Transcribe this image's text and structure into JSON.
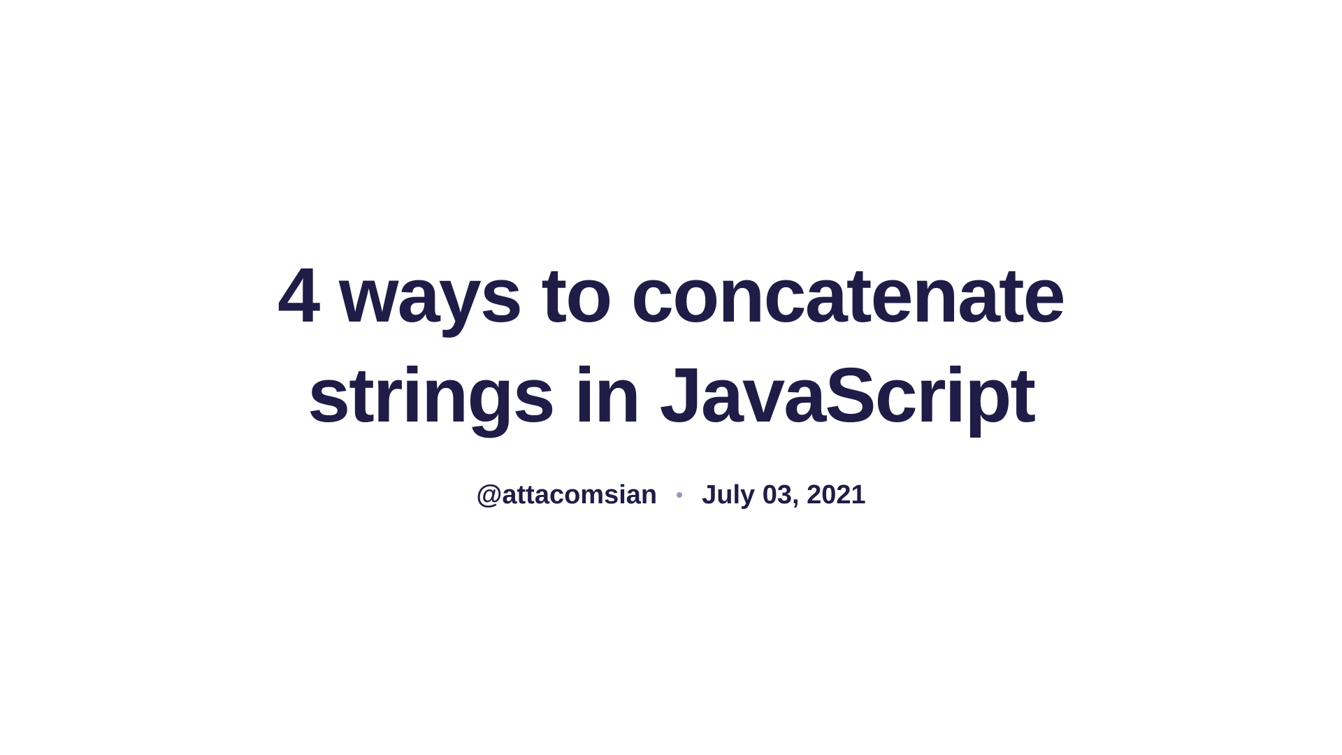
{
  "title": "4 ways to concatenate strings in JavaScript",
  "meta": {
    "author": "@attacomsian",
    "date": "July 03, 2021"
  }
}
